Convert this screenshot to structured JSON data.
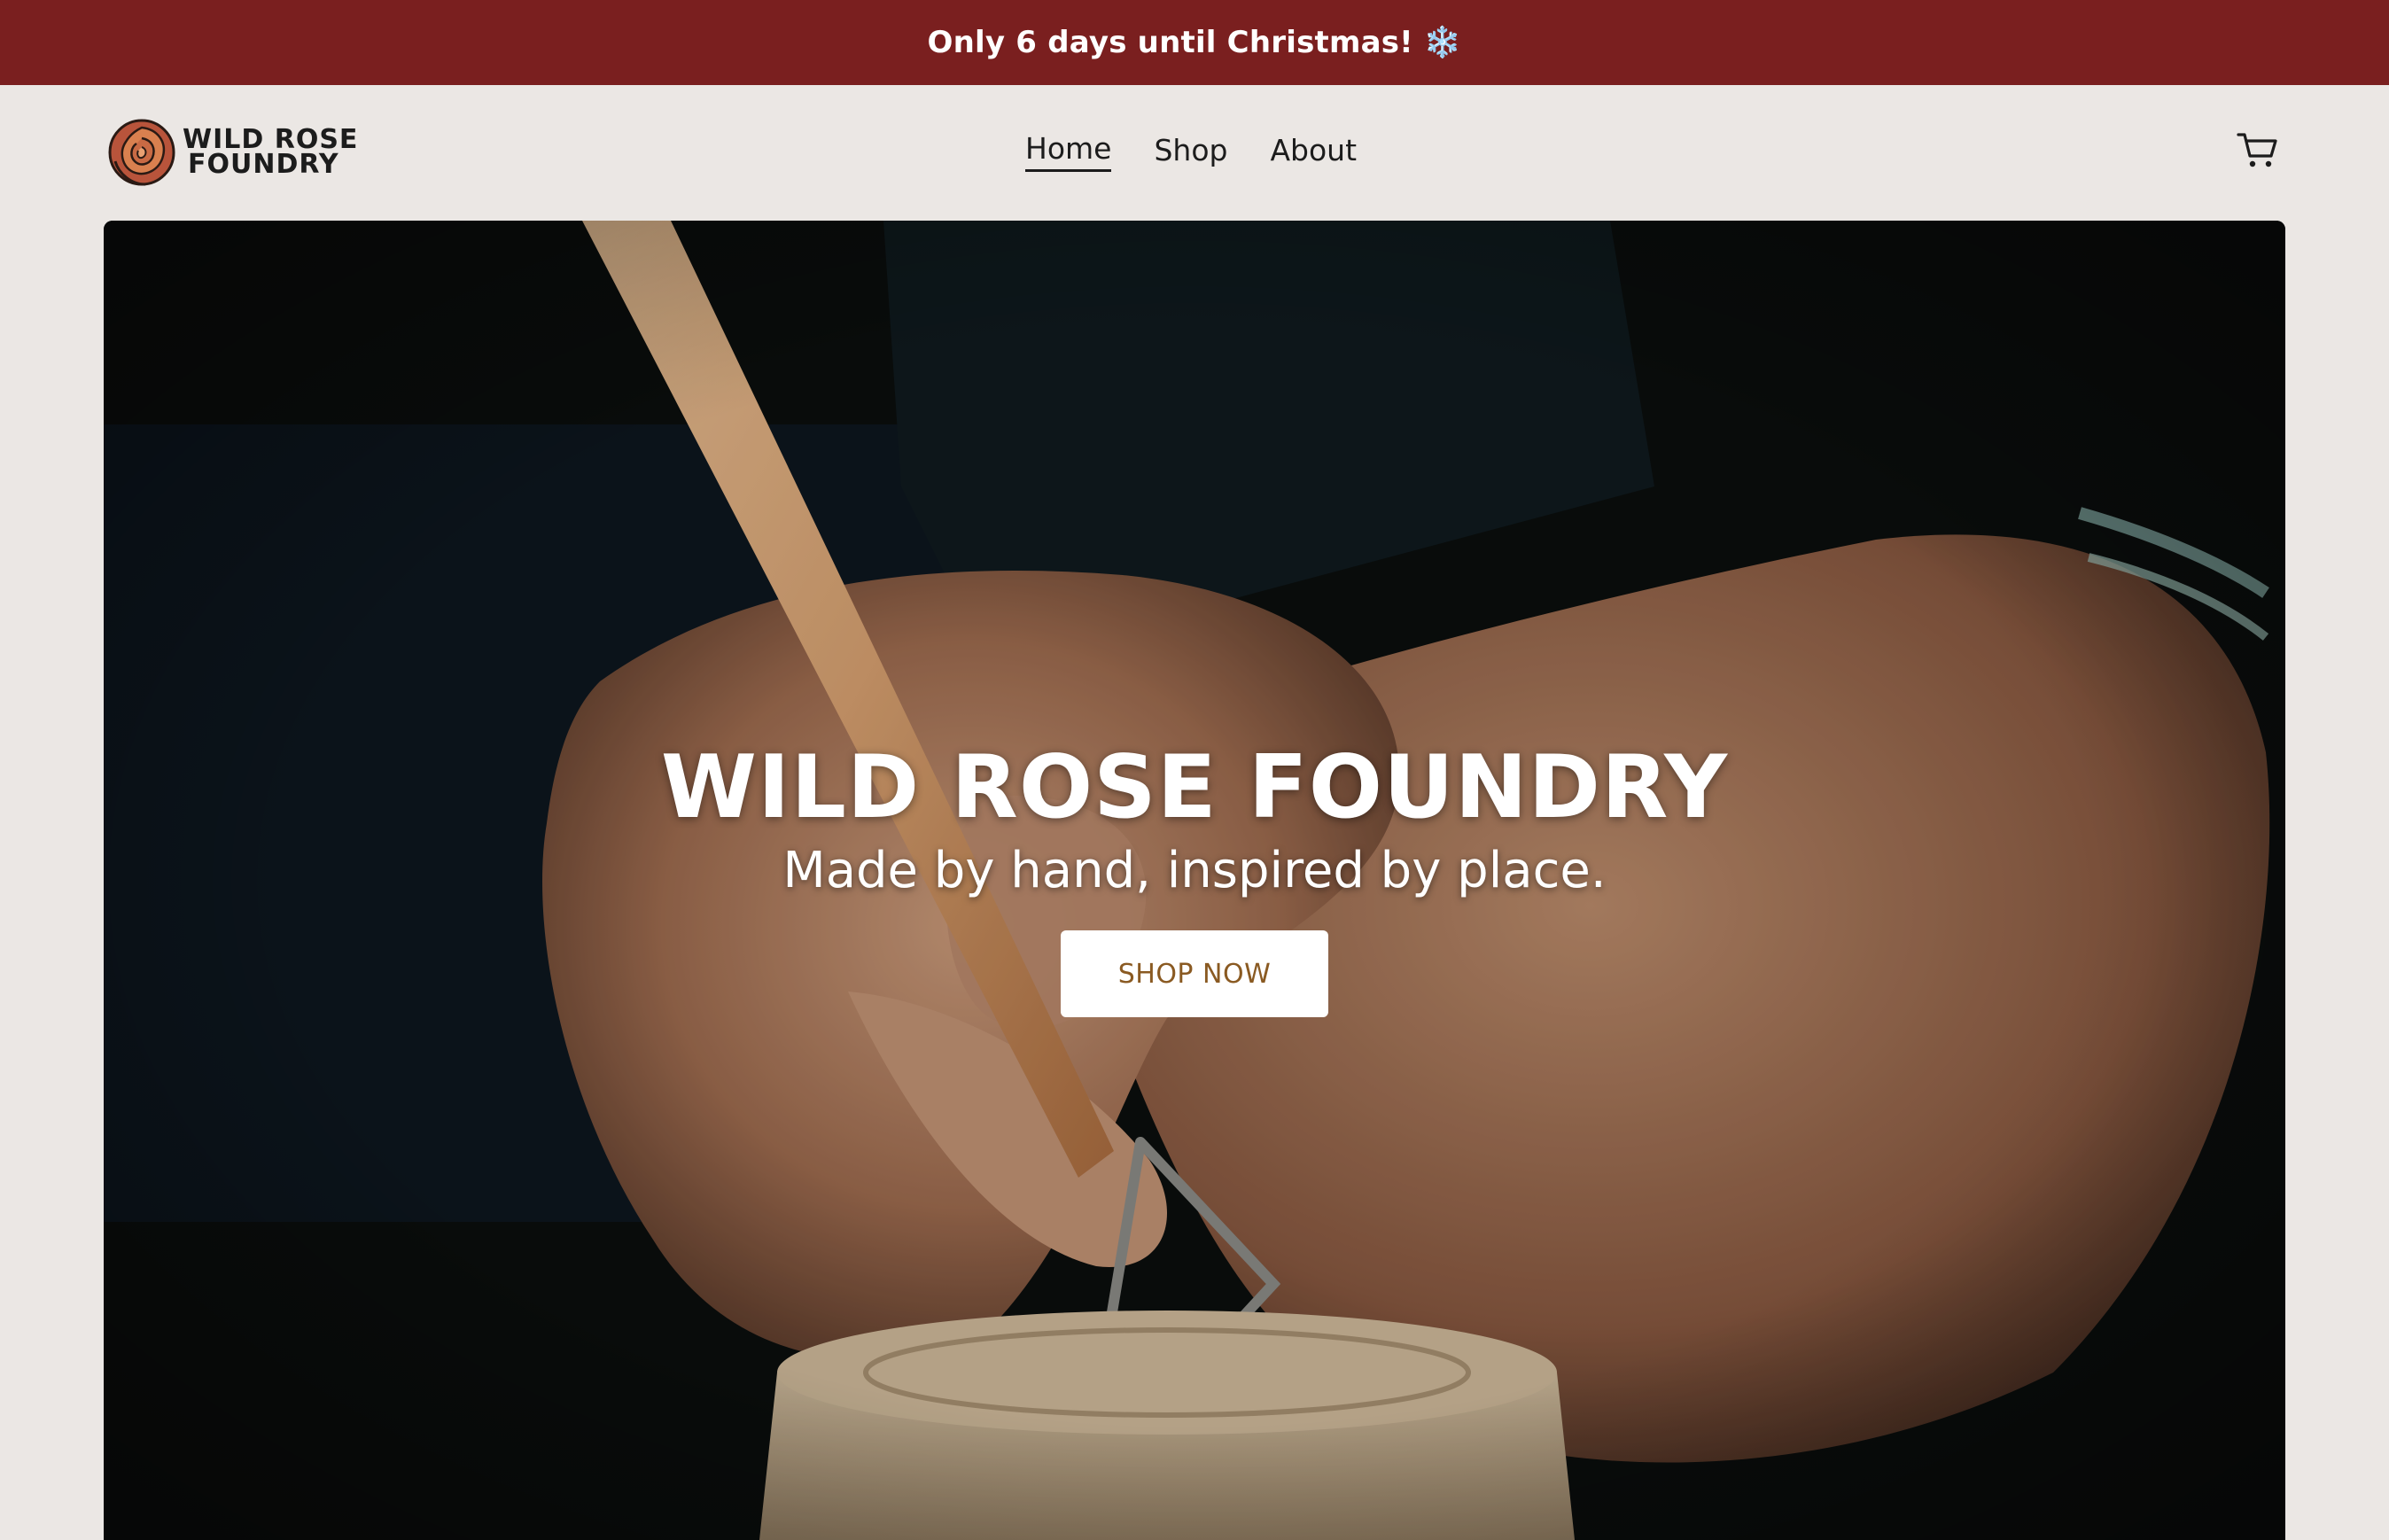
{
  "announcement": {
    "text": "Only 6 days until Christmas! ❄️"
  },
  "header": {
    "logo": {
      "line1": "WILD ROSE",
      "line2": "FOUNDRY"
    },
    "nav": [
      {
        "label": "Home",
        "active": true
      },
      {
        "label": "Shop",
        "active": false
      },
      {
        "label": "About",
        "active": false
      }
    ],
    "cart_icon": "cart-icon"
  },
  "hero": {
    "title": "WILD ROSE FOUNDRY",
    "subtitle": "Made by hand, inspired by place.",
    "cta_label": "SHOP NOW"
  },
  "colors": {
    "announcement_bg": "#7a1f1f",
    "page_bg": "#ebe7e4",
    "cta_text": "#8a5a22"
  }
}
